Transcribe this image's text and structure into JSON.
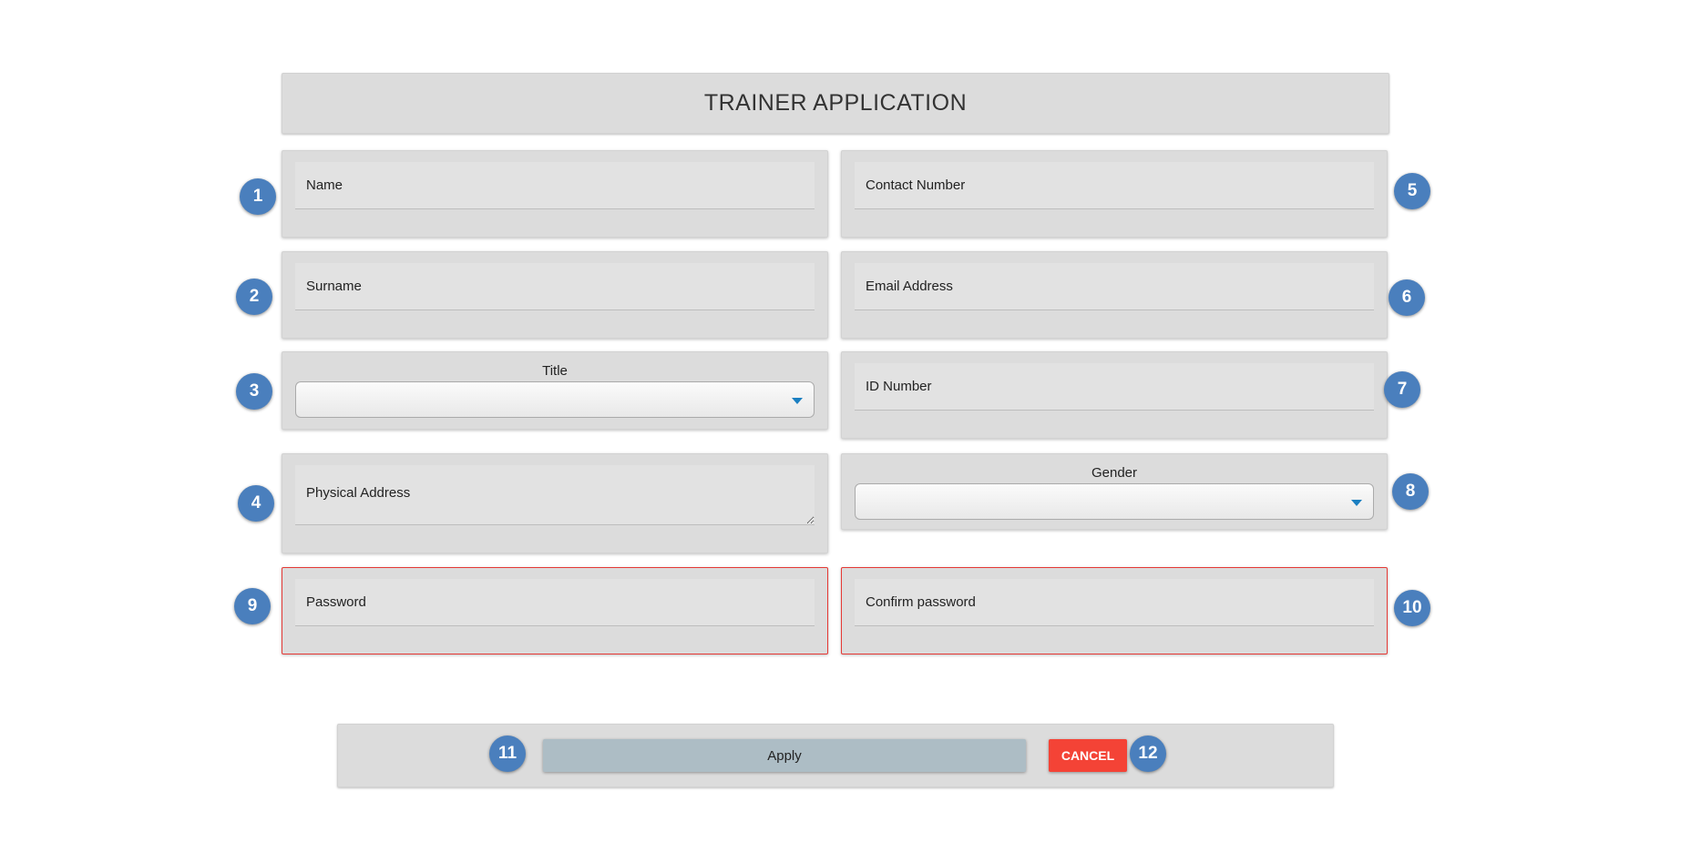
{
  "header": {
    "title": "TRAINER APPLICATION"
  },
  "fields": {
    "name": {
      "placeholder": "Name"
    },
    "surname": {
      "placeholder": "Surname"
    },
    "title": {
      "label": "Title",
      "value": ""
    },
    "physical_address": {
      "placeholder": "Physical Address"
    },
    "password": {
      "placeholder": "Password"
    },
    "contact_number": {
      "placeholder": "Contact Number"
    },
    "email": {
      "placeholder": "Email Address"
    },
    "id_number": {
      "placeholder": "ID Number"
    },
    "gender": {
      "label": "Gender",
      "value": ""
    },
    "confirm_password": {
      "placeholder": "Confirm password"
    }
  },
  "actions": {
    "apply_label": "Apply",
    "cancel_label": "CANCEL"
  },
  "badges": [
    "1",
    "2",
    "3",
    "4",
    "5",
    "6",
    "7",
    "8",
    "9",
    "10",
    "11",
    "12"
  ],
  "colors": {
    "badge": "#4a7fbd",
    "error_border": "#e53935",
    "cancel": "#f44336",
    "apply": "#adbdc5",
    "caret": "#1a7fc1"
  },
  "icons": {
    "select_caret": "caret-down-icon"
  }
}
